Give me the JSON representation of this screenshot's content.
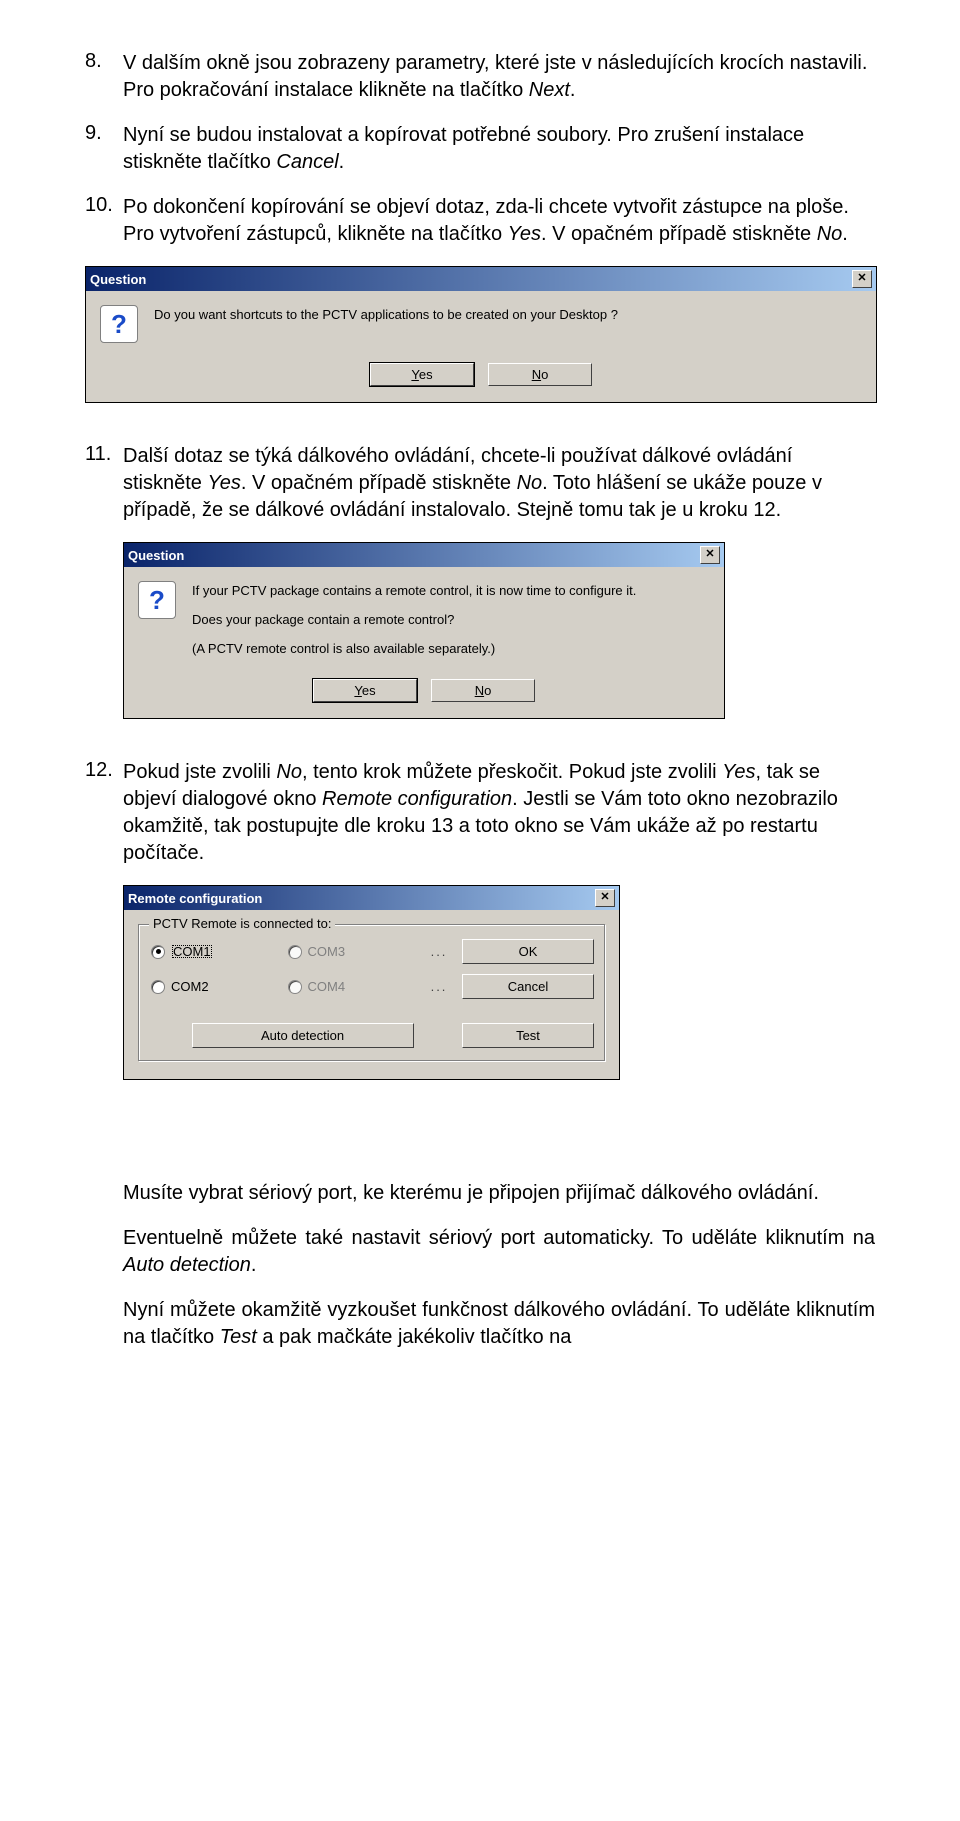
{
  "items": {
    "n8": {
      "num": "8.",
      "text_a": "V dalším okně jsou zobrazeny parametry, které jste v následujících krocích nastavili. Pro pokračování instalace klikněte na tlačítko ",
      "italic_a": "Next",
      "tail_a": "."
    },
    "n9": {
      "num": "9.",
      "text_a": "Nyní se budou instalovat a kopírovat potřebné soubory. Pro zrušení instalace stiskněte tlačítko ",
      "italic_a": "Cancel",
      "tail_a": "."
    },
    "n10": {
      "num": "10.",
      "text_a": "Po dokončení kopírování se objeví dotaz, zda-li chcete vytvořit zástupce na ploše. Pro vytvoření zástupců, klikněte na tlačítko ",
      "italic_a": "Yes",
      "mid_a": ". V opačném případě stiskněte ",
      "italic_b": "No",
      "tail_a": "."
    },
    "n11": {
      "num": "11.",
      "text_a": "Další dotaz se týká dálkového ovládání, chcete-li používat dálkové ovládání stiskněte ",
      "italic_a": "Yes",
      "mid_a": ". V opačném případě stiskněte ",
      "italic_b": "No",
      "tail_a": ". Toto hlášení se ukáže pouze v případě, že se dálkové ovládání instalovalo. Stejně tomu tak je u kroku 12."
    },
    "n12": {
      "num": "12.",
      "text_a": "Pokud jste zvolili ",
      "italic_a": "No",
      "mid_a": ", tento krok můžete přeskočit. Pokud jste zvolili ",
      "italic_b": "Yes",
      "mid_b": ", tak se objeví dialogové okno ",
      "italic_c": "Remote configuration",
      "tail_a": ". Jestli se Vám toto okno nezobrazilo okamžitě, tak postupujte dle kroku 13 a toto okno se Vám ukáže až po restartu počítače."
    }
  },
  "dlg1": {
    "title": "Question",
    "text": "Do you want shortcuts to the PCTV applications to be created on your Desktop ?",
    "yes_u": "Y",
    "yes_r": "es",
    "no_u": "N",
    "no_r": "o"
  },
  "dlg2": {
    "title": "Question",
    "line1": "If your PCTV package contains a remote control,  it is now time to configure it.",
    "line2": "Does your package contain a remote control?",
    "line3": "(A PCTV remote control is also available separately.)",
    "yes_u": "Y",
    "yes_r": "es",
    "no_u": "N",
    "no_r": "o"
  },
  "dlg3": {
    "title": "Remote configuration",
    "group_label": "PCTV Remote is connected to:",
    "com1": "COM1",
    "com2": "COM2",
    "com3": "COM3",
    "com4": "COM4",
    "ok_u": "O",
    "ok_r": "K",
    "cancel_u": "C",
    "cancel_r": "ancel",
    "test_u": "T",
    "test_r": "est",
    "auto_pre": "A",
    "auto_u": "u",
    "auto_post": "to detection",
    "dots": "..."
  },
  "footer": {
    "p1": "Musíte vybrat sériový port, ke kterému je připojen přijímač dálkového ovládání.",
    "p2_a": "Eventuelně  můžete  také  nastavit  sériový  port  automaticky. To uděláte kliknutím na ",
    "p2_i": "Auto detection",
    "p2_b": ".",
    "p3_a": "Nyní můžete okamžitě vyzkoušet funkčnost dálkového ovládání. To uděláte kliknutím na tlačítko ",
    "p3_i": "Test",
    "p3_b": " a pak mačkáte jakékoliv tlačítko na"
  }
}
